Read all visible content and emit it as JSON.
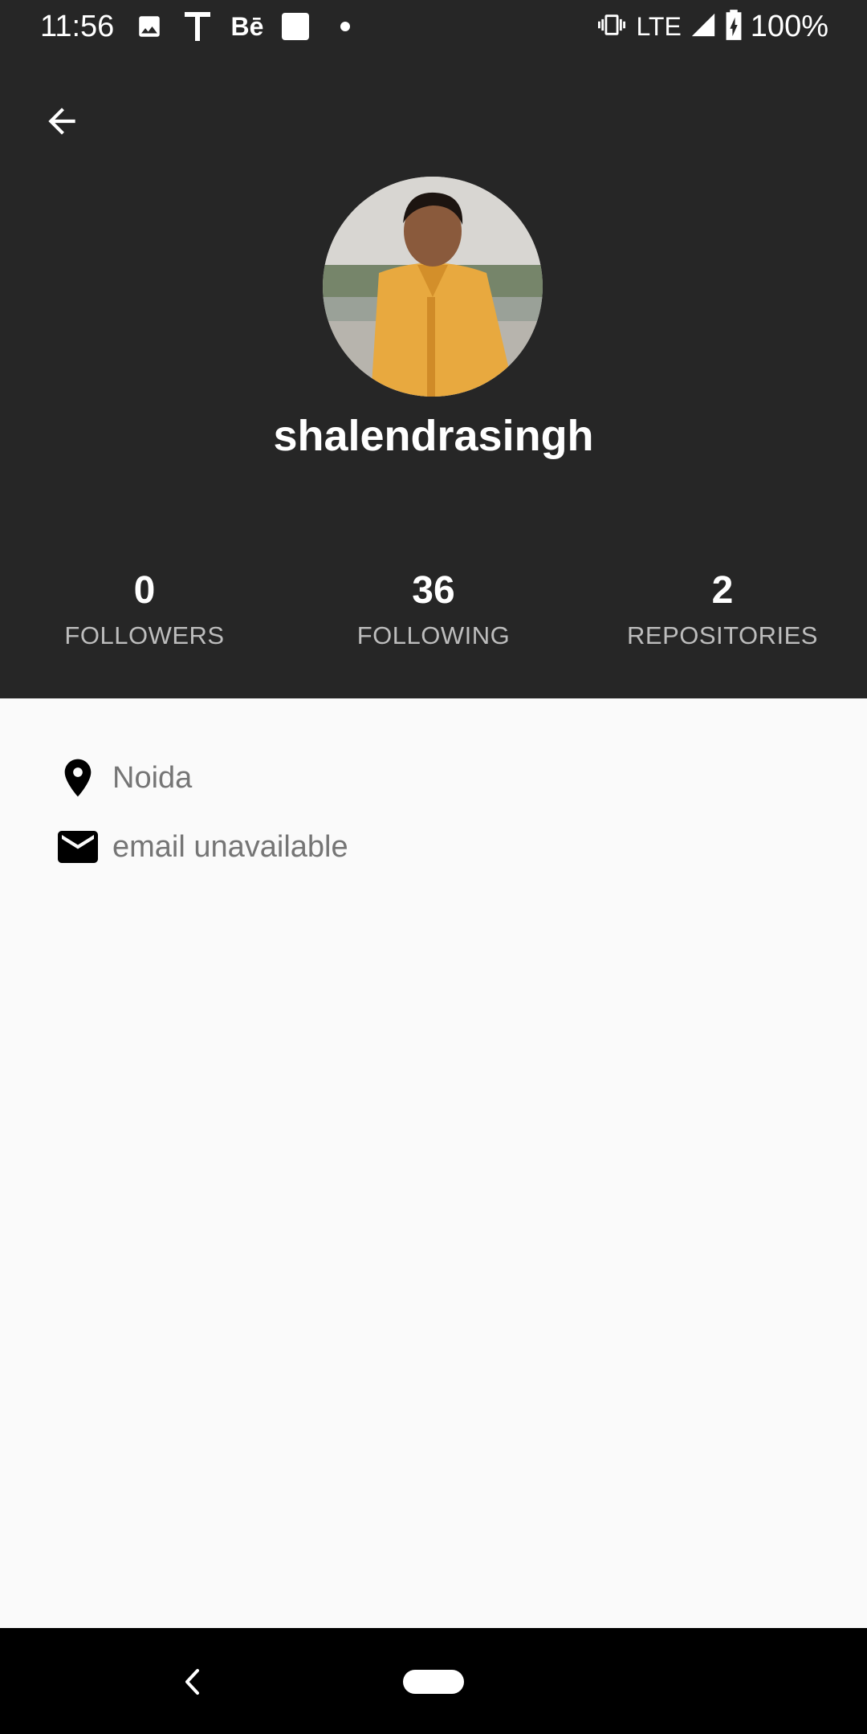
{
  "status_bar": {
    "time": "11:56",
    "notification_icons": [
      "image-icon",
      "t-icon",
      "behance-icon",
      "square-icon",
      "dot-icon"
    ],
    "behance_label": "Bē",
    "network": "LTE",
    "battery": "100%"
  },
  "toolbar": {
    "back_icon": "arrow-left-icon"
  },
  "profile": {
    "username": "shalendrasingh",
    "stats": [
      {
        "value": "0",
        "label": "FOLLOWERS"
      },
      {
        "value": "36",
        "label": "FOLLOWING"
      },
      {
        "value": "2",
        "label": "REPOSITORIES"
      }
    ]
  },
  "details": {
    "location": "Noida",
    "email": "email unavailable"
  },
  "colors": {
    "header_bg": "#262626",
    "content_bg": "#fafafa",
    "detail_text": "#757575",
    "stat_label": "#bdbdbd"
  }
}
